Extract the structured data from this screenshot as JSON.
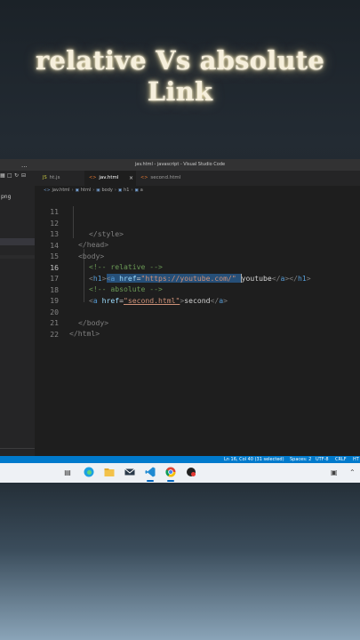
{
  "overlay": {
    "line1": "relative Vs absolute",
    "line2": "Link"
  },
  "window": {
    "title": "jav.html - javascript - Visual Studio Code"
  },
  "sidebar": {
    "more": "···",
    "file_fragment": "png"
  },
  "tabs": [
    {
      "icon": "JS",
      "label": "ht.js",
      "active": false
    },
    {
      "icon": "<>",
      "label": "jav.html",
      "active": true,
      "close": "×"
    },
    {
      "icon": "<>",
      "label": "second.html",
      "active": false
    }
  ],
  "breadcrumb": {
    "items": [
      "jav.html",
      "html",
      "body",
      "h1",
      "a"
    ]
  },
  "editor": {
    "lines": [
      {
        "n": "11",
        "code": ""
      },
      {
        "n": "12",
        "code": "</style>"
      },
      {
        "n": "13",
        "code": "</head>"
      },
      {
        "n": "14",
        "code": "<body>"
      },
      {
        "n": "15",
        "code": "<!-- relative -->"
      },
      {
        "n": "16",
        "code": "<h1><a href=\"https://youtube.com/\" youtube</a></h1>"
      },
      {
        "n": "17",
        "code": "<!-- absolute -->"
      },
      {
        "n": "18",
        "code": "<a href=\"second.html\">second</a>"
      },
      {
        "n": "19",
        "code": ""
      },
      {
        "n": "20",
        "code": "</body>"
      },
      {
        "n": "21",
        "code": "</html>"
      },
      {
        "n": "22",
        "code": ""
      }
    ],
    "active_line": "16"
  },
  "statusbar": {
    "position": "Ln 16, Col 40 (31 selected)",
    "spaces": "Spaces: 2",
    "encoding": "UTF-8",
    "eol": "CRLF",
    "language": "HT"
  },
  "taskbar": {
    "icons": [
      "task-view-icon",
      "edge-icon",
      "file-explorer-icon",
      "mail-icon",
      "vscode-icon",
      "chrome-icon",
      "app-icon"
    ]
  }
}
